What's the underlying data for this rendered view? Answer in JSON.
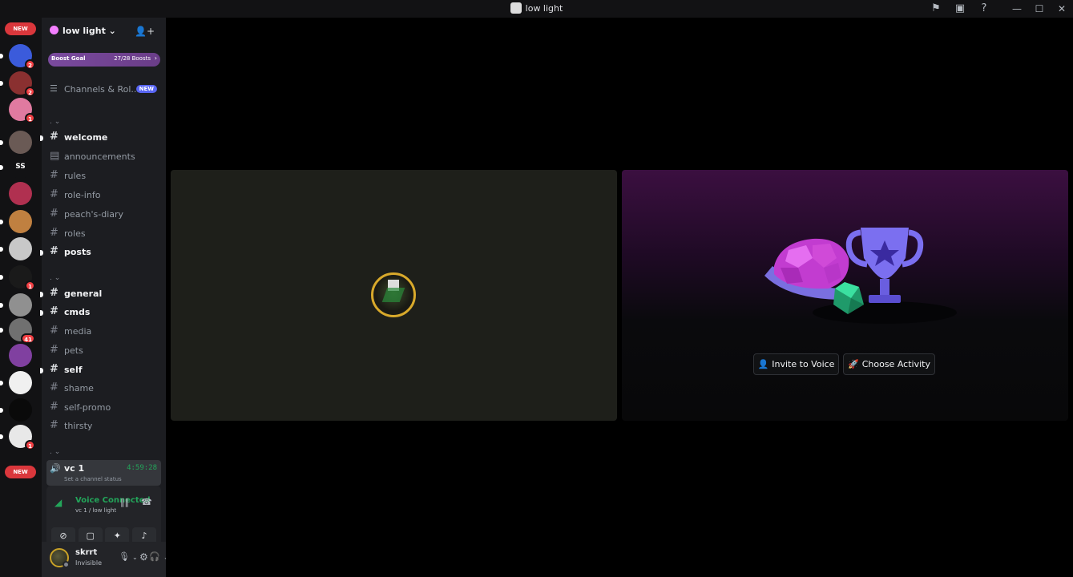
{
  "window": {
    "title": "low light"
  },
  "titlebar_icons": [
    "flag-icon",
    "inbox-icon",
    "help-icon"
  ],
  "window_controls": [
    "minimize",
    "maximize",
    "close"
  ],
  "rail": {
    "new_badge_top": "NEW",
    "new_badge_bottom": "NEW",
    "servers": [
      {
        "name": "server-1",
        "badge": "2",
        "color": "#3b5bdb"
      },
      {
        "name": "server-2",
        "badge": "2",
        "color": "#8a3030"
      },
      {
        "name": "server-3",
        "badge": "1",
        "color": "#e07aa0"
      },
      {
        "name": "server-4",
        "badge": "",
        "color": "#6a5a55"
      },
      {
        "name": "server-ss",
        "badge": "",
        "text": "SS"
      },
      {
        "name": "server-5",
        "badge": "",
        "color": "#b03050"
      },
      {
        "name": "server-6",
        "badge": "",
        "color": "#c08040"
      },
      {
        "name": "server-7",
        "badge": "",
        "color": "#c8c8c8"
      },
      {
        "name": "server-8",
        "badge": "1",
        "color": "#1a1a1a"
      },
      {
        "name": "server-9",
        "badge": "",
        "color": "#909090"
      },
      {
        "name": "server-10",
        "badge": "41",
        "color": "#707070"
      },
      {
        "name": "server-11",
        "badge": "",
        "color": "#8040a0"
      },
      {
        "name": "server-12",
        "badge": "",
        "color": "#f0f0f0"
      },
      {
        "name": "server-13",
        "badge": "",
        "color": "#0a0a0a"
      },
      {
        "name": "server-14",
        "badge": "1",
        "color": "#e8e8e8"
      }
    ]
  },
  "server": {
    "name": "low light",
    "boost_label": "Boost Goal",
    "boost_value": "27/28 Boosts",
    "channels_roles": "Channels & Rol...",
    "channels_roles_badge": "NEW",
    "channels": [
      {
        "name": "welcome",
        "unread": true,
        "icon": "#"
      },
      {
        "name": "announcements",
        "unread": false,
        "icon": "announce"
      },
      {
        "name": "rules",
        "unread": false,
        "icon": "#"
      },
      {
        "name": "role-info",
        "unread": false,
        "icon": "#"
      },
      {
        "name": "peach's-diary",
        "unread": false,
        "icon": "#"
      },
      {
        "name": "roles",
        "unread": false,
        "icon": "#"
      },
      {
        "name": "posts",
        "unread": true,
        "icon": "#"
      },
      {
        "name": "general",
        "unread": true,
        "icon": "#"
      },
      {
        "name": "cmds",
        "unread": true,
        "icon": "#"
      },
      {
        "name": "media",
        "unread": false,
        "icon": "#"
      },
      {
        "name": "pets",
        "unread": false,
        "icon": "#"
      },
      {
        "name": "self",
        "unread": true,
        "icon": "#"
      },
      {
        "name": "shame",
        "unread": false,
        "icon": "#"
      },
      {
        "name": "self-promo",
        "unread": false,
        "icon": "#"
      },
      {
        "name": "thirsty",
        "unread": false,
        "icon": "#"
      }
    ],
    "voice_channel": {
      "name": "vc 1",
      "time": "4:59:28",
      "status": "Set a channel status"
    }
  },
  "voice_panel": {
    "title": "Voice Connected",
    "subtitle": "vc 1 / low light"
  },
  "user": {
    "name": "skrrt",
    "status": "Invisible"
  },
  "main": {
    "invite_label": "Invite to Voice",
    "activity_label": "Choose Activity"
  }
}
